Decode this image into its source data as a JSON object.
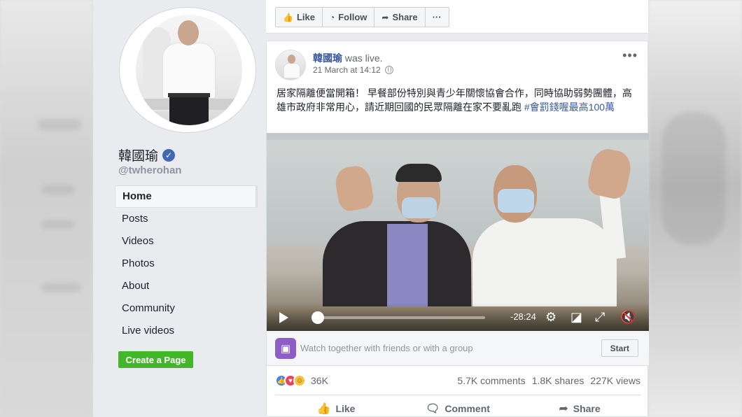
{
  "action_bar": {
    "like_label": "Like",
    "follow_label": "Follow",
    "share_label": "Share",
    "more_label": "···"
  },
  "sidebar": {
    "page_name": "韓國瑜",
    "handle": "@twherohan",
    "nav": [
      {
        "label": "Home",
        "active": true
      },
      {
        "label": "Posts"
      },
      {
        "label": "Videos"
      },
      {
        "label": "Photos"
      },
      {
        "label": "About"
      },
      {
        "label": "Community"
      },
      {
        "label": "Live videos"
      }
    ],
    "create_page_label": "Create a Page"
  },
  "post": {
    "author": "韓國瑜",
    "status": "was live.",
    "timestamp": "21 March at 14:12",
    "more_label": "•••",
    "text": "居家隔離便當開箱！ 早餐部份特別與青少年關懷協會合作，同時協助弱勢團體，高雄市政府非常用心，請近期回國的民眾隔離在家不要亂跑 ",
    "hashtag": "#會罰錢喔最高100萬",
    "video": {
      "time_remaining": "-28:24",
      "progress": 0.0
    },
    "watch_party": {
      "text": "Watch together with friends or with a group",
      "start_label": "Start"
    },
    "stats": {
      "reactions_count": "36K",
      "comments": "5.7K comments",
      "shares": "1.8K shares",
      "views": "227K views"
    },
    "actions": {
      "like": "Like",
      "comment": "Comment",
      "share": "Share"
    }
  },
  "icons": {
    "verified": "verified-badge-icon",
    "globe": "globe-icon",
    "accent_color": "#4267b2",
    "create_page_color": "#42b72a"
  }
}
